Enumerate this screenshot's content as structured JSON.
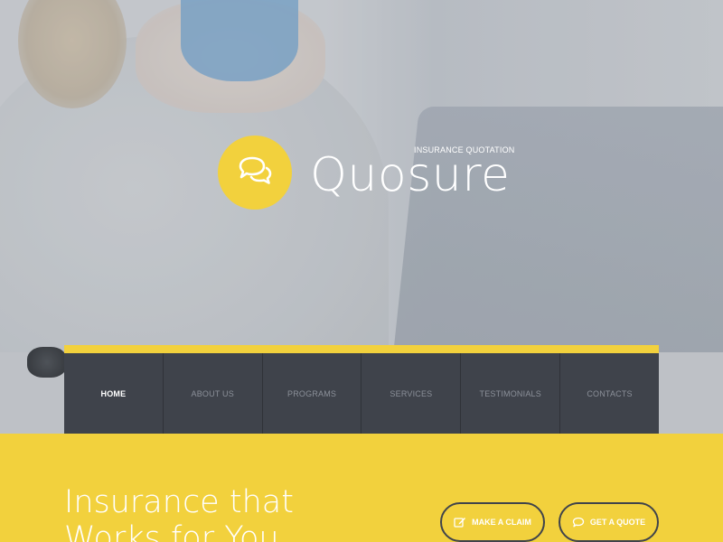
{
  "brand": {
    "name": "Quosure",
    "tagline": "INSURANCE QUOTATION",
    "logo_icon": "chat-bubbles-icon",
    "accent_color": "#f2d13d"
  },
  "nav": {
    "items": [
      {
        "label": "HOME",
        "active": true
      },
      {
        "label": "ABOUT US",
        "active": false
      },
      {
        "label": "PROGRAMS",
        "active": false
      },
      {
        "label": "SERVICES",
        "active": false
      },
      {
        "label": "TESTIMONIALS",
        "active": false
      },
      {
        "label": "CONTACTS",
        "active": false
      }
    ],
    "background_color": "#3f434b"
  },
  "promo": {
    "heading_line1": "Insurance that",
    "heading_line2": "Works for You",
    "buttons": [
      {
        "label": "MAKE A CLAIM",
        "icon": "edit-icon"
      },
      {
        "label": "GET A QUOTE",
        "icon": "chat-bubble-icon"
      }
    ]
  }
}
